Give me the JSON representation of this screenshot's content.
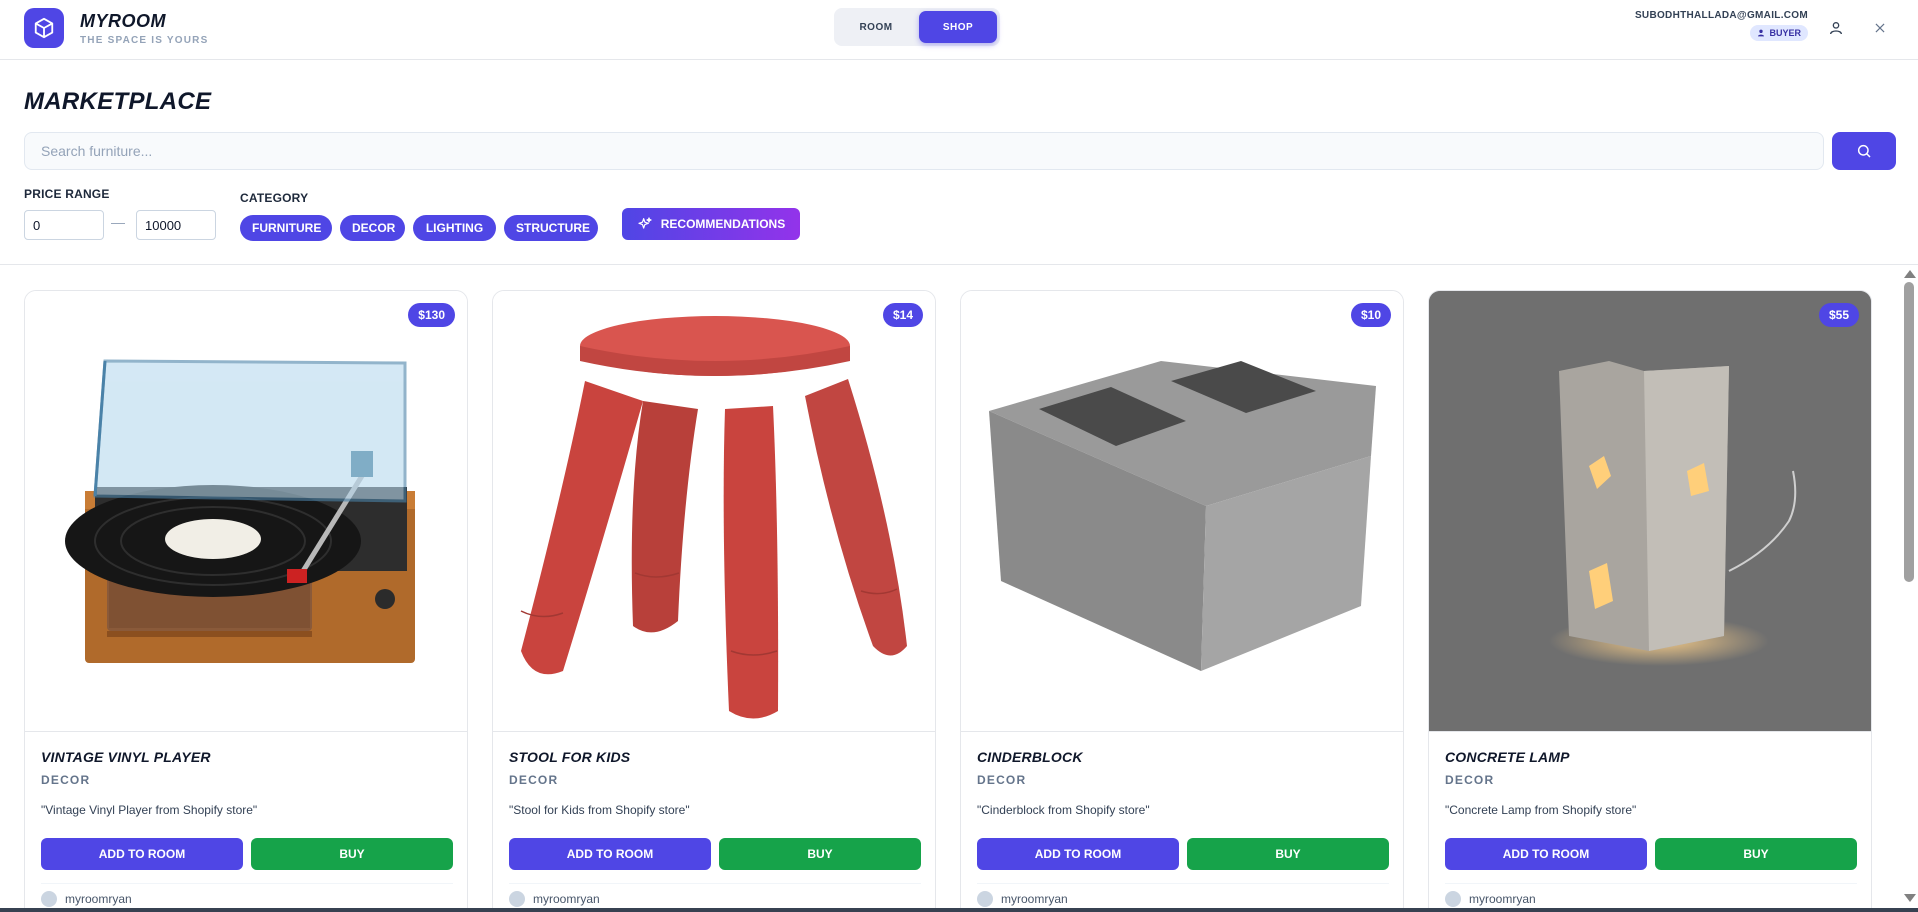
{
  "brand": {
    "name": "MYROOM",
    "tagline": "THE SPACE IS YOURS"
  },
  "mode_toggle": {
    "room_label": "ROOM",
    "shop_label": "SHOP",
    "active": "SHOP"
  },
  "user": {
    "email": "SUBODHTHALLADA@GMAIL.COM",
    "role": "BUYER"
  },
  "icons": {
    "logo": "cube-icon",
    "profile": "user-icon",
    "close": "close-icon",
    "search": "search-icon",
    "recommend": "sparkles-icon"
  },
  "page": {
    "title": "MARKETPLACE"
  },
  "search": {
    "placeholder": "Search furniture...",
    "value": ""
  },
  "filters": {
    "price_label": "PRICE RANGE",
    "price_min": "0",
    "price_max": "10000",
    "category_label": "CATEGORY",
    "categories": [
      "FURNITURE",
      "DECOR",
      "LIGHTING",
      "STRUCTURE"
    ],
    "recommendations_label": "RECOMMENDATIONS"
  },
  "colors": {
    "accent": "#4f46e5",
    "buy": "#16a34a",
    "gradient_end": "#9333ea"
  },
  "products": [
    {
      "title": "VINTAGE VINYL PLAYER",
      "category": "DECOR",
      "price": "$130",
      "description": "\"Vintage Vinyl Player from Shopify store\"",
      "add_label": "ADD TO ROOM",
      "buy_label": "BUY",
      "seller": "myroomryan"
    },
    {
      "title": "STOOL FOR KIDS",
      "category": "DECOR",
      "price": "$14",
      "description": "\"Stool for Kids from Shopify store\"",
      "add_label": "ADD TO ROOM",
      "buy_label": "BUY",
      "seller": "myroomryan"
    },
    {
      "title": "CINDERBLOCK",
      "category": "DECOR",
      "price": "$10",
      "description": "\"Cinderblock from Shopify store\"",
      "add_label": "ADD TO ROOM",
      "buy_label": "BUY",
      "seller": "myroomryan"
    },
    {
      "title": "CONCRETE LAMP",
      "category": "DECOR",
      "price": "$55",
      "description": "\"Concrete Lamp from Shopify store\"",
      "add_label": "ADD TO ROOM",
      "buy_label": "BUY",
      "seller": "myroomryan"
    }
  ]
}
